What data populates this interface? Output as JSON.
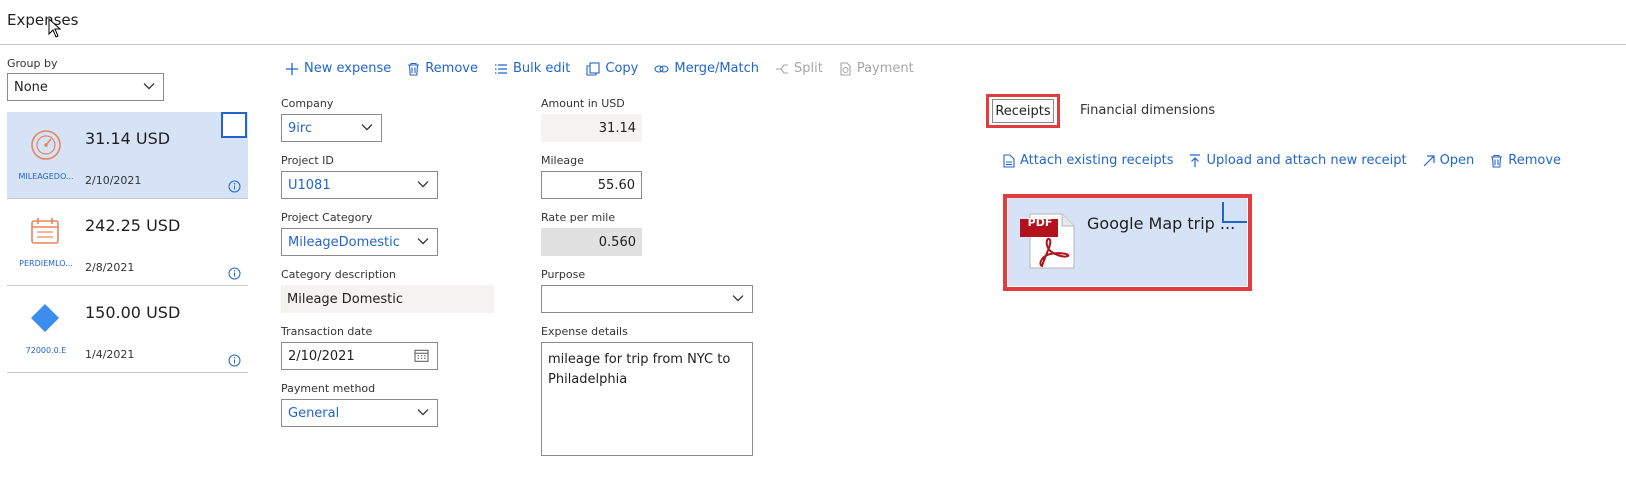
{
  "page": {
    "title": "Expenses"
  },
  "group_by": {
    "label": "Group by",
    "value": "None"
  },
  "toolbar": {
    "new_expense": "New expense",
    "remove": "Remove",
    "bulk_edit": "Bulk edit",
    "copy": "Copy",
    "merge_match": "Merge/Match",
    "split": "Split",
    "payment": "Payment"
  },
  "expenses": [
    {
      "amount": "31.14 USD",
      "date": "2/10/2021",
      "category": "MILEAGEDO...",
      "icon": "speedometer-icon",
      "color": "#e9835f"
    },
    {
      "amount": "242.25 USD",
      "date": "2/8/2021",
      "category": "PERDIEMLO...",
      "icon": "calendar-icon",
      "color": "#e9835f"
    },
    {
      "amount": "150.00 USD",
      "date": "1/4/2021",
      "category": "72000.0.E",
      "icon": "diamond-icon",
      "color": "#3b8ef0"
    }
  ],
  "form": {
    "company": {
      "label": "Company",
      "value": "9irc"
    },
    "project_id": {
      "label": "Project ID",
      "value": "U1081"
    },
    "project_category": {
      "label": "Project Category",
      "value": "MileageDomestic"
    },
    "category_description": {
      "label": "Category description",
      "value": "Mileage Domestic"
    },
    "transaction_date": {
      "label": "Transaction date",
      "value": "2/10/2021"
    },
    "payment_method": {
      "label": "Payment method",
      "value": "General"
    },
    "amount_usd": {
      "label": "Amount in USD",
      "value": "31.14"
    },
    "mileage": {
      "label": "Mileage",
      "value": "55.60"
    },
    "rate_per_mile": {
      "label": "Rate per mile",
      "value": "0.560"
    },
    "purpose": {
      "label": "Purpose",
      "value": ""
    },
    "expense_details": {
      "label": "Expense details",
      "value": "mileage for trip from NYC to Philadelphia"
    }
  },
  "right_tabs": {
    "receipts": "Receipts",
    "financial_dimensions": "Financial dimensions"
  },
  "receipt_actions": {
    "attach_existing": "Attach existing receipts",
    "upload_attach": "Upload and attach new receipt",
    "open": "Open",
    "remove": "Remove"
  },
  "receipt": {
    "name": "Google Map trip ...",
    "file_type": "PDF"
  },
  "colors": {
    "accent": "#2266cc",
    "selection": "#d6e3f7",
    "highlight_box": "#e23c3c"
  }
}
